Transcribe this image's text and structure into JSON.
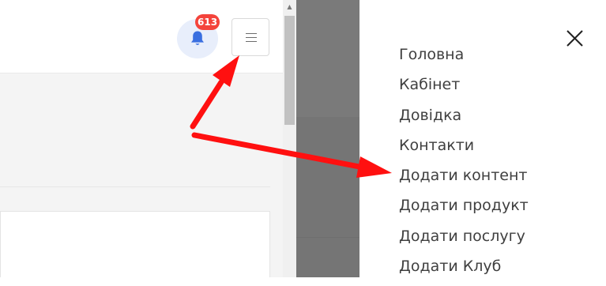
{
  "header": {
    "notification_count": "613"
  },
  "icons": {
    "bell": "bell-icon",
    "hamburger": "hamburger-icon",
    "close": "close-icon",
    "scroll_up": "chevron-up-icon"
  },
  "colors": {
    "badge": "#f4433b",
    "bell": "#3a6fe0",
    "annotation_arrow": "#ff1010",
    "menu_text": "#3f3f3f"
  },
  "menu": {
    "items": [
      {
        "label": "Головна"
      },
      {
        "label": "Кабінет"
      },
      {
        "label": "Довідка"
      },
      {
        "label": "Контакти"
      },
      {
        "label": "Додати контент"
      },
      {
        "label": "Додати продукт"
      },
      {
        "label": "Додати послугу"
      },
      {
        "label": "Додати Клуб"
      }
    ]
  }
}
